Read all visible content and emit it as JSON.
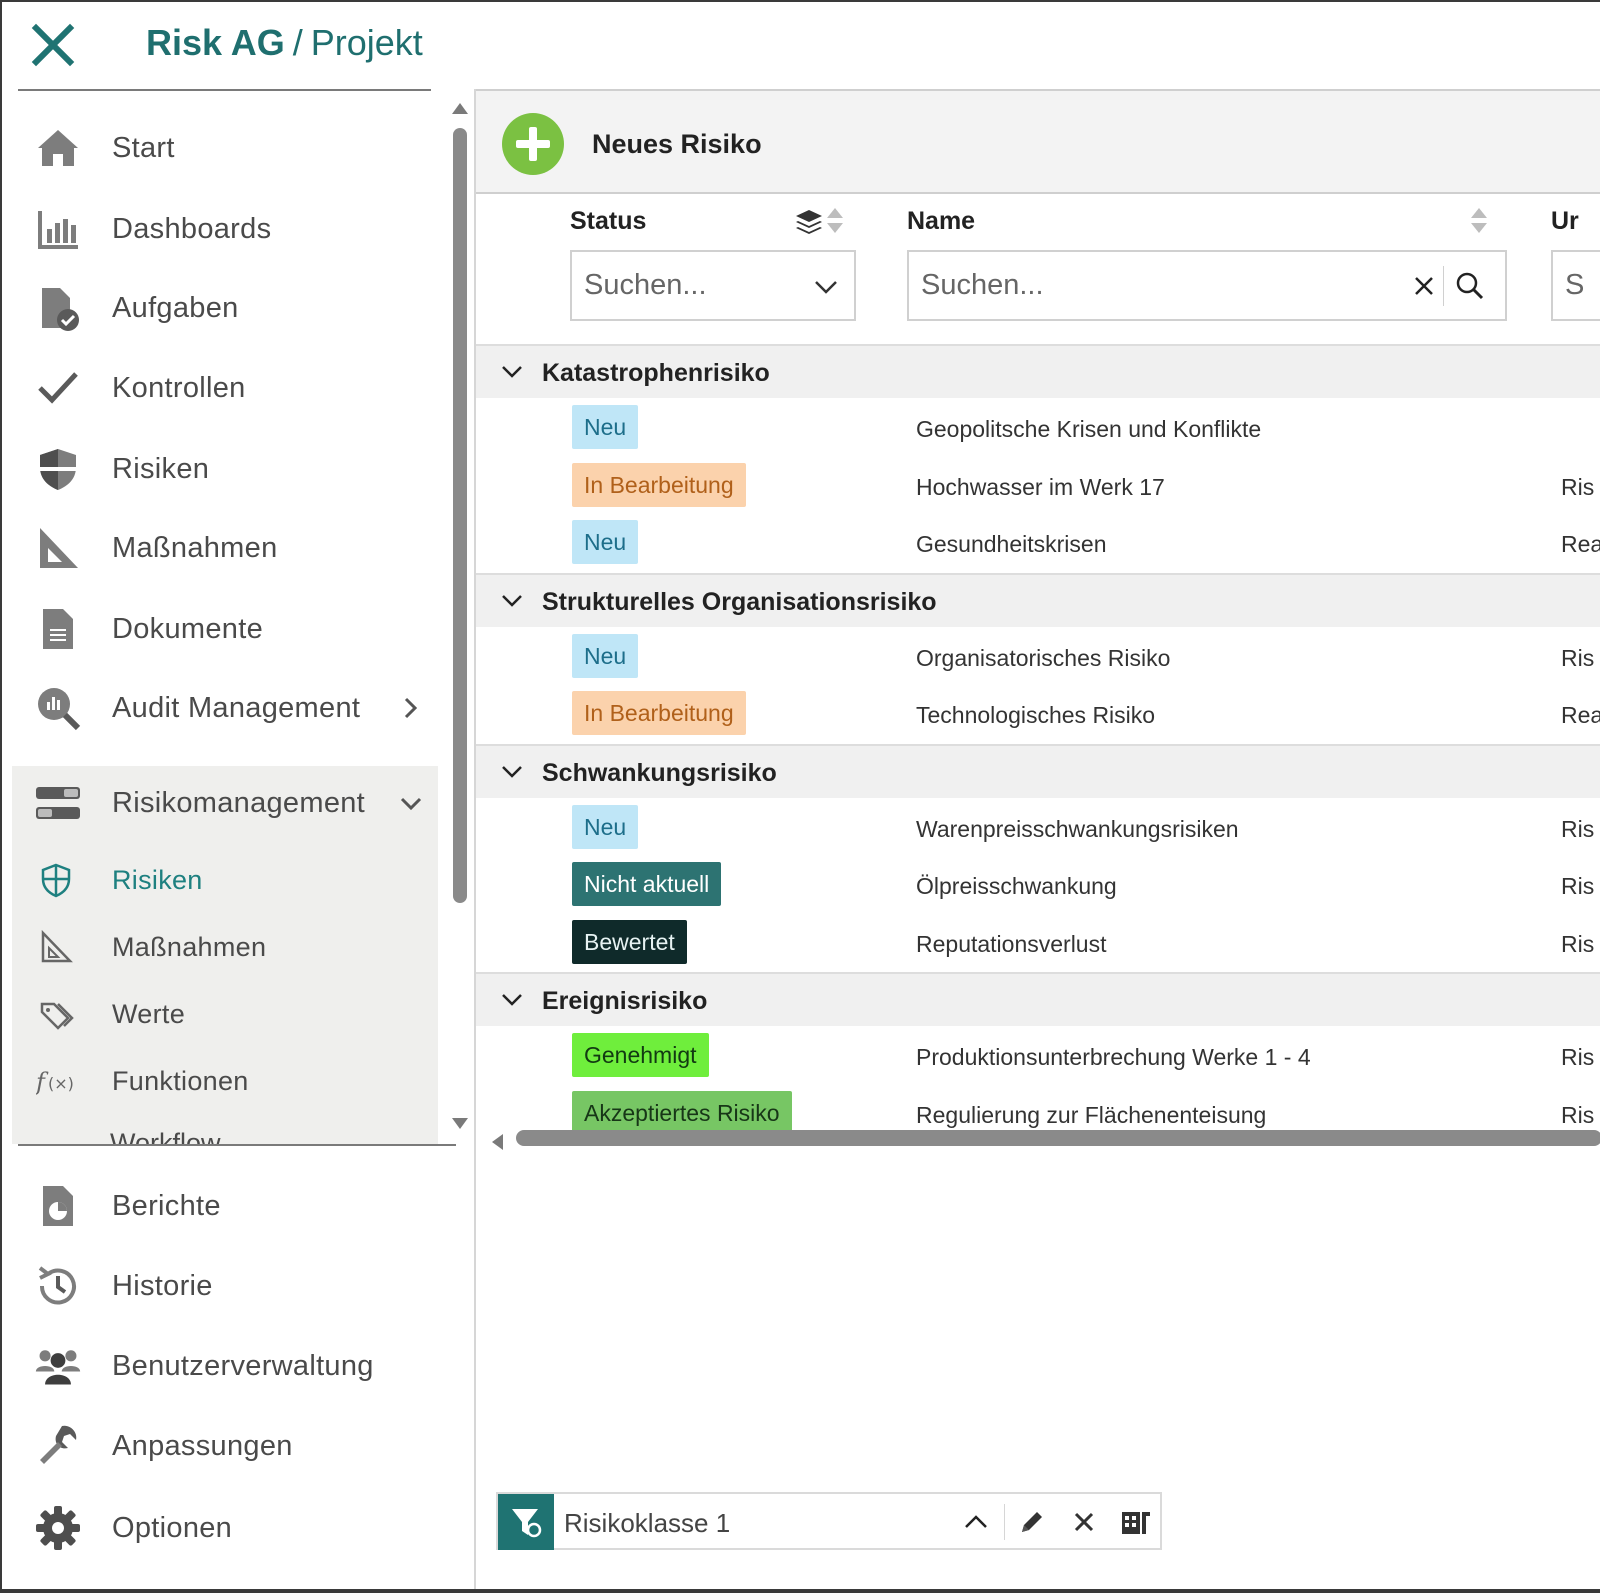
{
  "header": {
    "org": "Risk AG",
    "separator": "/",
    "section": "Projekt"
  },
  "sidebar": {
    "items": [
      {
        "label": "Start",
        "icon": "home-icon"
      },
      {
        "label": "Dashboards",
        "icon": "bar-chart-icon"
      },
      {
        "label": "Aufgaben",
        "icon": "task-document-icon"
      },
      {
        "label": "Kontrollen",
        "icon": "checkmark-icon"
      },
      {
        "label": "Risiken",
        "icon": "shield-icon"
      },
      {
        "label": "Maßnahmen",
        "icon": "set-square-icon"
      },
      {
        "label": "Dokumente",
        "icon": "document-icon"
      },
      {
        "label": "Audit Management",
        "icon": "magnifier-chart-icon"
      },
      {
        "label": "Risikomanagement",
        "icon": "toggle-list-icon"
      }
    ],
    "submenu": [
      {
        "label": "Risiken",
        "icon": "shield-outline-icon",
        "active": true
      },
      {
        "label": "Maßnahmen",
        "icon": "set-square-outline-icon"
      },
      {
        "label": "Werte",
        "icon": "tags-icon"
      },
      {
        "label": "Funktionen",
        "icon": "function-icon"
      }
    ],
    "clipped_item": "Workflow",
    "bottom_items": [
      {
        "label": "Berichte",
        "icon": "report-icon"
      },
      {
        "label": "Historie",
        "icon": "history-icon"
      },
      {
        "label": "Benutzerverwaltung",
        "icon": "users-icon"
      },
      {
        "label": "Anpassungen",
        "icon": "wrench-icon"
      },
      {
        "label": "Optionen",
        "icon": "gear-icon"
      }
    ]
  },
  "toolbar": {
    "new_label": "Neues Risiko"
  },
  "columns": {
    "status": "Status",
    "name": "Name",
    "third": "Ur"
  },
  "filters": {
    "status_placeholder": "Suchen...",
    "name_placeholder": "Suchen...",
    "third_placeholder": "S"
  },
  "colors": {
    "accent": "#1f7372",
    "new_green": "#7bc142",
    "neu_bg": "#bfe6f7",
    "neu_fg": "#1d6e8a",
    "bearbeitung_bg": "#fbd2ac",
    "bearbeitung_fg": "#b0601a",
    "nicht_aktuell_bg": "#2d7372",
    "bewertet_bg": "#0f2a2a",
    "genehmigt_bg": "#6fee3c",
    "akzeptiert_bg": "#77c664"
  },
  "groups": [
    {
      "label": "Katastrophenrisiko",
      "rows": [
        {
          "status": "Neu",
          "status_key": "neu",
          "name": "Geopolitsche Krisen und Konflikte",
          "extra": ""
        },
        {
          "status": "In Bearbeitung",
          "status_key": "bearbeitung",
          "name": "Hochwasser im Werk 17",
          "extra": "Ris"
        },
        {
          "status": "Neu",
          "status_key": "neu",
          "name": "Gesundheitskrisen",
          "extra": "Rea"
        }
      ]
    },
    {
      "label": "Strukturelles Organisationsrisiko",
      "rows": [
        {
          "status": "Neu",
          "status_key": "neu",
          "name": "Organisatorisches Risiko",
          "extra": "Ris"
        },
        {
          "status": "In Bearbeitung",
          "status_key": "bearbeitung",
          "name": "Technologisches Risiko",
          "extra": "Rea"
        }
      ]
    },
    {
      "label": "Schwankungsrisiko",
      "rows": [
        {
          "status": "Neu",
          "status_key": "neu",
          "name": "Warenpreisschwankungsrisiken",
          "extra": "Ris"
        },
        {
          "status": "Nicht aktuell",
          "status_key": "nicht_aktuell",
          "name": "Ölpreisschwankung",
          "extra": "Ris"
        },
        {
          "status": "Bewertet",
          "status_key": "bewertet",
          "name": "Reputationsverlust",
          "extra": "Ris"
        }
      ]
    },
    {
      "label": "Ereignisrisiko",
      "rows": [
        {
          "status": "Genehmigt",
          "status_key": "genehmigt",
          "name": "Produktionsunterbrechung Werke 1 - 4",
          "extra": "Ris"
        },
        {
          "status": "Akzeptiertes Risiko",
          "status_key": "akzeptiert",
          "name": "Regulierung zur Flächenenteisung",
          "extra": "Ris"
        }
      ]
    }
  ],
  "filterbar": {
    "label": "Risikoklasse 1"
  }
}
